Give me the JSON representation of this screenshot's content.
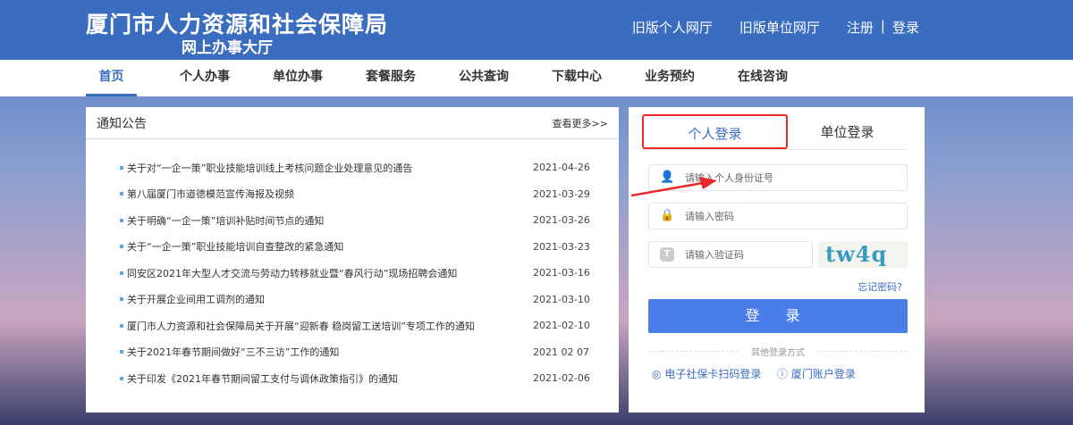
{
  "header": {
    "title": "厦门市人力资源和社会保障局",
    "subtitle": "网上办事大厅",
    "links": [
      "旧版个人网厅",
      "旧版单位网厅",
      "注册",
      "登录"
    ],
    "sep": "|"
  },
  "nav": [
    "首页",
    "个人办事",
    "单位办事",
    "套餐服务",
    "公共查询",
    "下载中心",
    "业务预约",
    "在线咨询"
  ],
  "notice": {
    "title": "通知公告",
    "more": "查看更多>>",
    "items": [
      {
        "title": "关于对“一企一策”职业技能培训线上考核问题企业处理意见的通告",
        "date": "2021-04-26"
      },
      {
        "title": "第八届厦门市道德模范宣传海报及视频",
        "date": "2021-03-29"
      },
      {
        "title": "关于明确“一企一策”培训补贴时间节点的通知",
        "date": "2021-03-26"
      },
      {
        "title": "关于“一企一策”职业技能培训自查整改的紧急通知",
        "date": "2021-03-23"
      },
      {
        "title": "同安区2021年大型人才交流与劳动力转移就业暨“春风行动”现场招聘会通知",
        "date": "2021-03-16"
      },
      {
        "title": "关于开展企业间用工调剂的通知",
        "date": "2021-03-10"
      },
      {
        "title": "厦门市人力资源和社会保障局关于开展“迎新春 稳岗留工送培训”专项工作的通知",
        "date": "2021-02-10"
      },
      {
        "title": "关于2021年春节期间做好“三不三访”工作的通知",
        "date": "2021 02 07"
      },
      {
        "title": "关于印发《2021年春节期间留工支付与调休政策指引》的通知",
        "date": "2021-02-06"
      }
    ]
  },
  "login": {
    "tabs": [
      "个人登录",
      "单位登录"
    ],
    "id_placeholder": "请输入个人身份证号",
    "pwd_placeholder": "请输入密码",
    "captcha_placeholder": "请输入验证码",
    "captcha_text": "tw4q",
    "forgot": "忘记密码?",
    "submit": "登 录",
    "other": "其他登录方式",
    "alt1": "电子社保卡扫码登录",
    "alt2": "厦门账户登录"
  }
}
